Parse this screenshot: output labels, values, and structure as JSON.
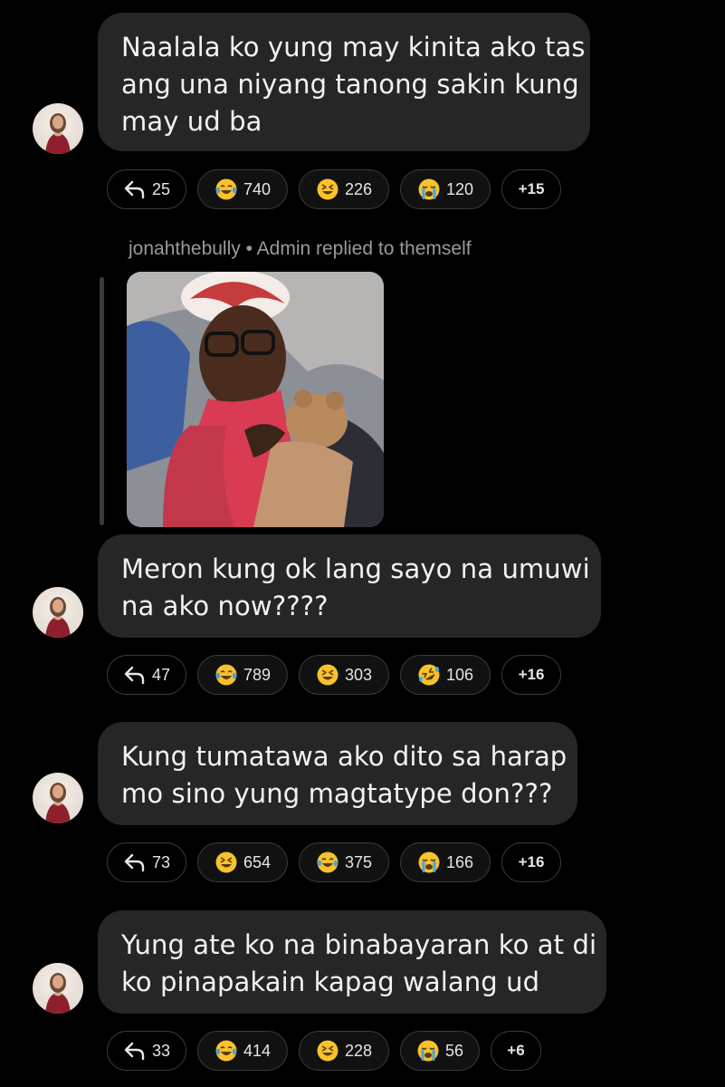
{
  "messages": [
    {
      "lines": [
        "Naalala ko yung may kinita ako tas",
        "ang una niyang tanong sakin kung",
        "may ud ba"
      ],
      "reply_count": "25",
      "reactions": [
        {
          "icon": "tears-of-joy-icon",
          "count": "740"
        },
        {
          "icon": "grinning-squint-icon",
          "count": "226"
        },
        {
          "icon": "loudly-crying-icon",
          "count": "120"
        }
      ],
      "more": "+15"
    },
    {
      "lines": [
        "Meron kung ok lang sayo na umuwi",
        "na ako now????"
      ],
      "reply_count": "47",
      "reactions": [
        {
          "icon": "tears-of-joy-icon",
          "count": "789"
        },
        {
          "icon": "grinning-squint-icon",
          "count": "303"
        },
        {
          "icon": "rolling-on-floor-laughing-icon",
          "count": "106"
        }
      ],
      "more": "+16"
    },
    {
      "lines": [
        "Kung tumatawa ako dito sa harap",
        "mo sino yung magtatype don???"
      ],
      "reply_count": "73",
      "reactions": [
        {
          "icon": "grinning-squint-icon",
          "count": "654"
        },
        {
          "icon": "tears-of-joy-icon",
          "count": "375"
        },
        {
          "icon": "loudly-crying-icon",
          "count": "166"
        }
      ],
      "more": "+16"
    },
    {
      "lines": [
        "Yung ate ko na binabayaran ko at di",
        "ko pinapakain kapag walang ud"
      ],
      "reply_count": "33",
      "reactions": [
        {
          "icon": "tears-of-joy-icon",
          "count": "414"
        },
        {
          "icon": "grinning-squint-icon",
          "count": "228"
        },
        {
          "icon": "loudly-crying-icon",
          "count": "56"
        }
      ],
      "more": "+6"
    }
  ],
  "reply_header": {
    "author": "jonahthebully",
    "separator": " • ",
    "role_text": "Admin replied to themself"
  },
  "colors": {
    "background": "#000000",
    "bubble": "#262626",
    "pill_border": "#3b3b3b",
    "muted_text": "#9a9a9a",
    "emoji_yellow": "#f7c22b",
    "tear_blue": "#4aa3df"
  }
}
